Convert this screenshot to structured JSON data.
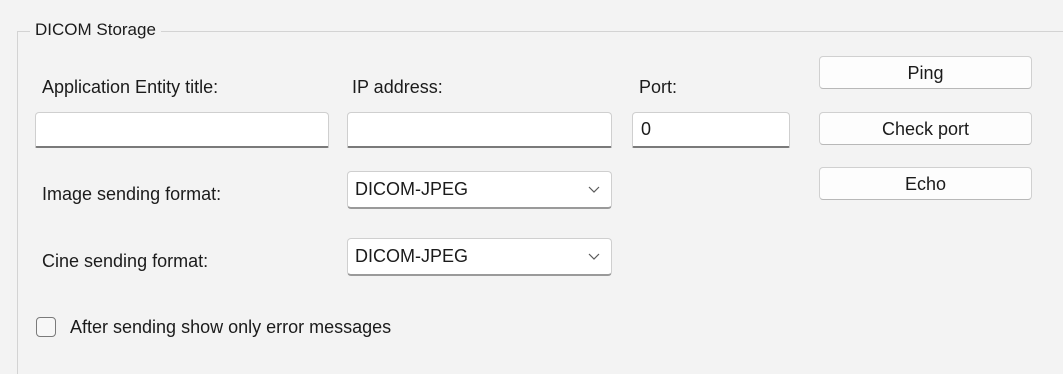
{
  "group": {
    "title": "DICOM Storage"
  },
  "fields": {
    "ae_title": {
      "label": "Application Entity title:",
      "value": ""
    },
    "ip_address": {
      "label": "IP address:",
      "value": ""
    },
    "port": {
      "label": "Port:",
      "value": "0"
    }
  },
  "formats": {
    "image": {
      "label": "Image sending format:",
      "selected": "DICOM-JPEG"
    },
    "cine": {
      "label": "Cine sending format:",
      "selected": "DICOM-JPEG"
    }
  },
  "buttons": {
    "ping": "Ping",
    "check_port": "Check port",
    "echo": "Echo"
  },
  "options": {
    "errors_only": {
      "label": "After sending show only error messages",
      "checked": false
    }
  },
  "icons": {
    "combo_arrow": "chevron-down-icon"
  }
}
